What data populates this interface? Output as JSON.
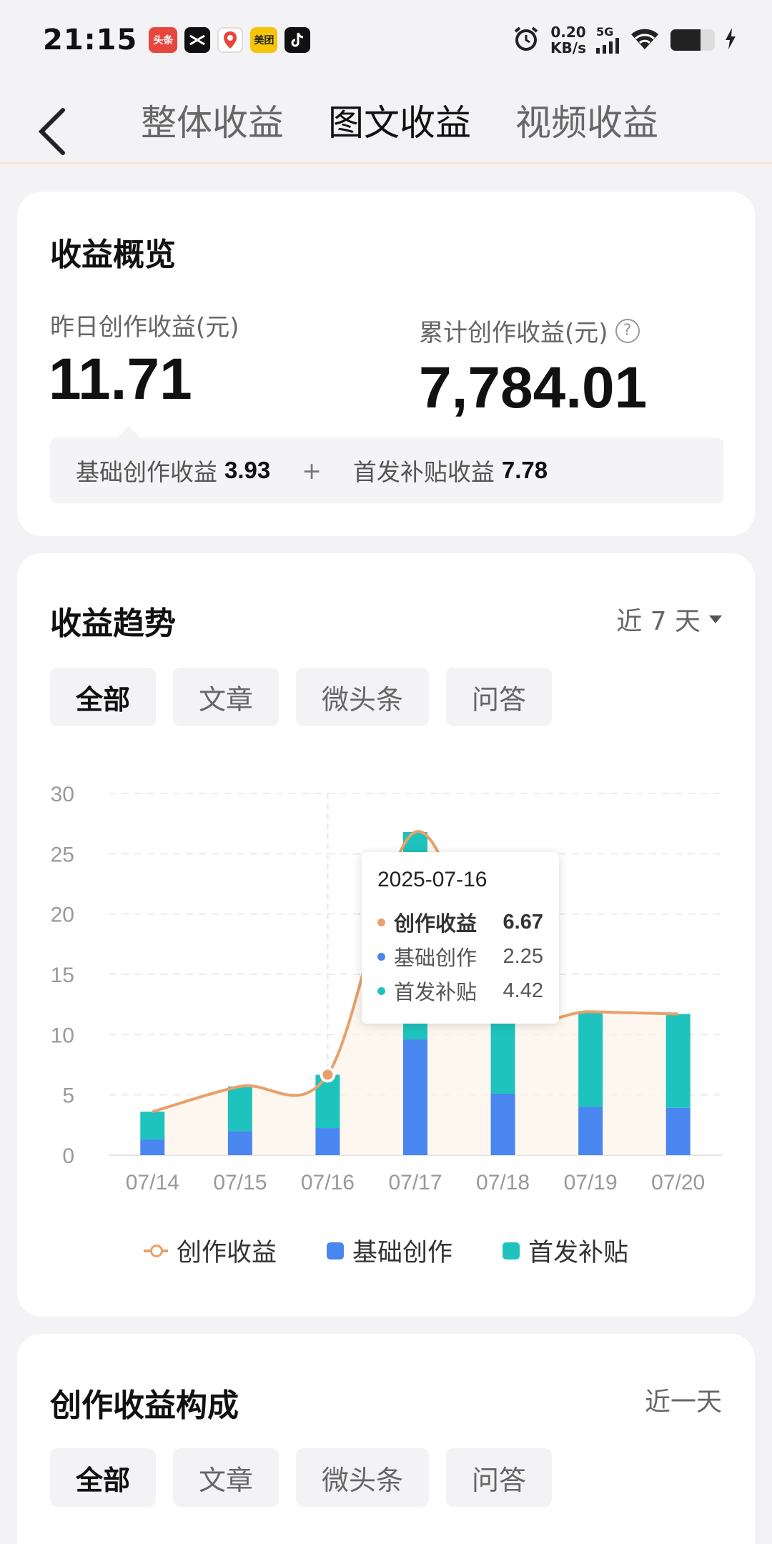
{
  "status_bar": {
    "time": "21:15",
    "apps": [
      "头条",
      "CapCut",
      "地图",
      "美团",
      "TikTok"
    ],
    "net_speed_value": "0.20",
    "net_speed_unit": "KB/s",
    "network": "5G",
    "battery_level": 0.68
  },
  "nav": {
    "tabs": [
      "整体收益",
      "图文收益",
      "视频收益"
    ],
    "active_tab": "图文收益"
  },
  "overview": {
    "title": "收益概览",
    "yesterday_label": "昨日创作收益(元)",
    "yesterday_value": "11.71",
    "total_label": "累计创作收益(元)",
    "total_value": "7,784.01",
    "base_label": "基础创作收益",
    "base_value": "3.93",
    "plus": "+",
    "first_label": "首发补贴收益",
    "first_value": "7.78"
  },
  "trend": {
    "title": "收益趋势",
    "range": "近 7 天",
    "filters": [
      "全部",
      "文章",
      "微头条",
      "问答"
    ],
    "active_filter": "全部",
    "legend": [
      "创作收益",
      "基础创作",
      "首发补贴"
    ],
    "tooltip": {
      "date": "2025-07-16",
      "rows": [
        {
          "name": "创作收益",
          "value": "6.67",
          "color": "#e9a06a"
        },
        {
          "name": "基础创作",
          "value": "2.25",
          "color": "#4a86f0"
        },
        {
          "name": "首发补贴",
          "value": "4.42",
          "color": "#1ec3bd"
        }
      ]
    }
  },
  "chart_data": {
    "type": "bar",
    "stacked": true,
    "categories": [
      "07/14",
      "07/15",
      "07/16",
      "07/17",
      "07/18",
      "07/19",
      "07/20"
    ],
    "series": [
      {
        "name": "基础创作",
        "type": "bar",
        "color": "#4a86f0",
        "values": [
          1.3,
          2.0,
          2.25,
          9.6,
          5.1,
          4.0,
          3.93
        ]
      },
      {
        "name": "首发补贴",
        "type": "bar",
        "color": "#1ec3bd",
        "values": [
          2.3,
          3.7,
          4.42,
          17.2,
          7.1,
          7.9,
          7.78
        ]
      },
      {
        "name": "创作收益",
        "type": "line",
        "color": "#e9a06a",
        "values": [
          3.6,
          5.7,
          6.67,
          26.8,
          12.2,
          11.9,
          11.71
        ]
      }
    ],
    "yticks": [
      0,
      5,
      10,
      15,
      20,
      25,
      30
    ],
    "ylim": [
      0,
      30
    ],
    "highlight": "07/16",
    "grid": true
  },
  "composition": {
    "title": "创作收益构成",
    "range": "近一天",
    "filters": [
      "全部",
      "文章",
      "微头条",
      "问答"
    ],
    "active_filter": "全部"
  }
}
